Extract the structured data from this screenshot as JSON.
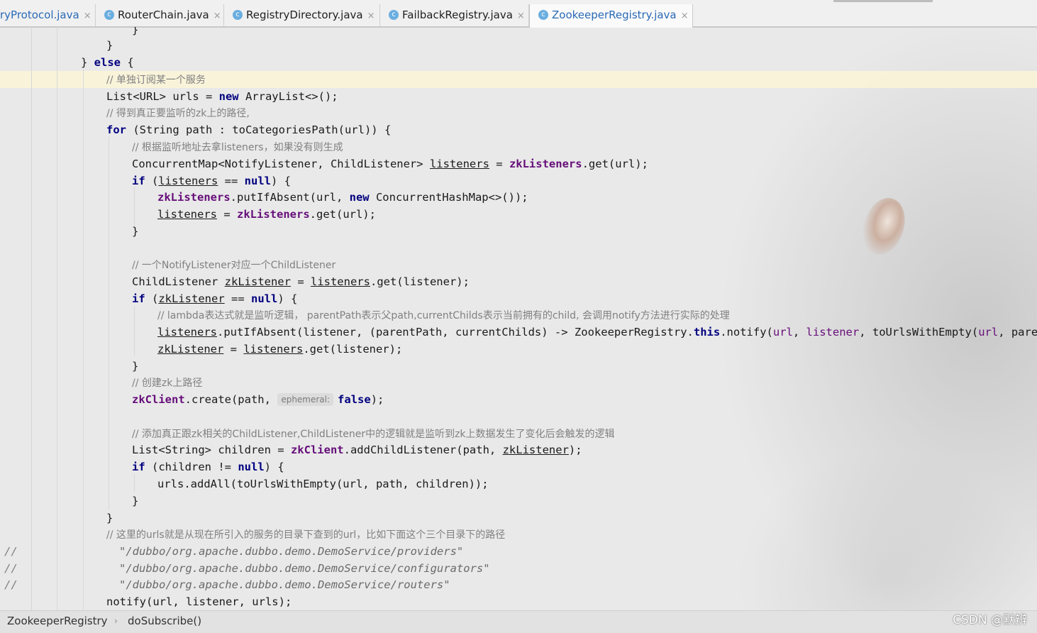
{
  "tabs": [
    {
      "label": "ryProtocol.java",
      "active": false
    },
    {
      "label": "RouterChain.java",
      "active": false
    },
    {
      "label": "RegistryDirectory.java",
      "active": false
    },
    {
      "label": "FailbackRegistry.java",
      "active": false
    },
    {
      "label": "ZookeeperRegistry.java",
      "active": true
    }
  ],
  "tab_icon_letter": "c",
  "tab_close_glyph": "×",
  "code": {
    "l01": "}",
    "l02": "}",
    "l03_brace": "} ",
    "l03_kw": "else",
    "l03_rest": " {",
    "l04": "// 单独订阅某一个服务",
    "l05": "List<URL> urls = ",
    "l05_kw": "new",
    "l05_rest": " ArrayList<>();",
    "l06": "// 得到真正要监听的zk上的路径,",
    "l07_kw": "for",
    "l07_rest": " (String path : toCategoriesPath(url)) {",
    "l08": "// 根据监听地址去拿listeners，如果没有则生成",
    "l09_a": "ConcurrentMap<NotifyListener, ChildListener> ",
    "l09_var": "listeners",
    "l09_b": " = ",
    "l09_fld": "zkListeners",
    "l09_c": ".get(url);",
    "l10_kw": "if",
    "l10_a": " (",
    "l10_var": "listeners",
    "l10_b": " == ",
    "l10_null": "null",
    "l10_c": ") {",
    "l11_fld": "zkListeners",
    "l11_a": ".putIfAbsent(url, ",
    "l11_kw": "new",
    "l11_b": " ConcurrentHashMap<>());",
    "l12_var": "listeners",
    "l12_a": " = ",
    "l12_fld": "zkListeners",
    "l12_b": ".get(url);",
    "l13": "}",
    "l14": "// 一个NotifyListener对应一个ChildListener",
    "l15_a": "ChildListener ",
    "l15_var": "zkListener",
    "l15_b": " = ",
    "l15_var2": "listeners",
    "l15_c": ".get(listener);",
    "l16_kw": "if",
    "l16_a": " (",
    "l16_var": "zkListener",
    "l16_b": " == ",
    "l16_null": "null",
    "l16_c": ") {",
    "l17": "// lambda表达式就是监听逻辑， parentPath表示父path,currentChilds表示当前拥有的child, 会调用notify方法进行实际的处理",
    "l18_var": "listeners",
    "l18_a": ".putIfAbsent(listener, (parentPath, currentChilds) -> ZookeeperRegistry.",
    "l18_this": "this",
    "l18_b": ".notify(",
    "l18_p1": "url",
    "l18_c": ", ",
    "l18_p2": "listener",
    "l18_d": ", toUrlsWithEmpty(",
    "l18_p3": "url",
    "l18_e": ", parentPat",
    "l19_var": "zkListener",
    "l19_a": " = ",
    "l19_var2": "listeners",
    "l19_b": ".get(listener);",
    "l20": "}",
    "l21": "// 创建zk上路径",
    "l22_fld": "zkClient",
    "l22_a": ".create(path, ",
    "l22_hint": "ephemeral:",
    "l22_false": "false",
    "l22_b": ");",
    "l23": "// 添加真正跟zk相关的ChildListener,ChildListener中的逻辑就是监听到zk上数据发生了变化后会触发的逻辑",
    "l24_a": "List<String> children = ",
    "l24_fld": "zkClient",
    "l24_b": ".addChildListener(path, ",
    "l24_var": "zkListener",
    "l24_c": ");",
    "l25_kw": "if",
    "l25_a": " (children != ",
    "l25_null": "null",
    "l25_b": ") {",
    "l26": "urls.addAll(toUrlsWithEmpty(url, path, children));",
    "l27": "}",
    "l28": "}",
    "l29": "// 这里的urls就是从现在所引入的服务的目录下查到的url，比如下面这个三个目录下的路径",
    "l30": "\"/dubbo/org.apache.dubbo.demo.DemoService/providers\"",
    "l31": "\"/dubbo/org.apache.dubbo.demo.DemoService/configurators\"",
    "l32": "\"/dubbo/org.apache.dubbo.demo.DemoService/routers\"",
    "l33": "notify(url, listener, urls);",
    "gutter_comment": "//"
  },
  "breadcrumb": {
    "class_name": "ZookeeperRegistry",
    "separator": "›",
    "method_name": "doSubscribe()"
  },
  "watermark": "CSDN @默辨",
  "colors": {
    "keyword": "#000080",
    "field": "#660e7a",
    "comment": "#808080",
    "highlight_row": "#fcf5d7",
    "active_tab_text": "#2a6ab5"
  }
}
